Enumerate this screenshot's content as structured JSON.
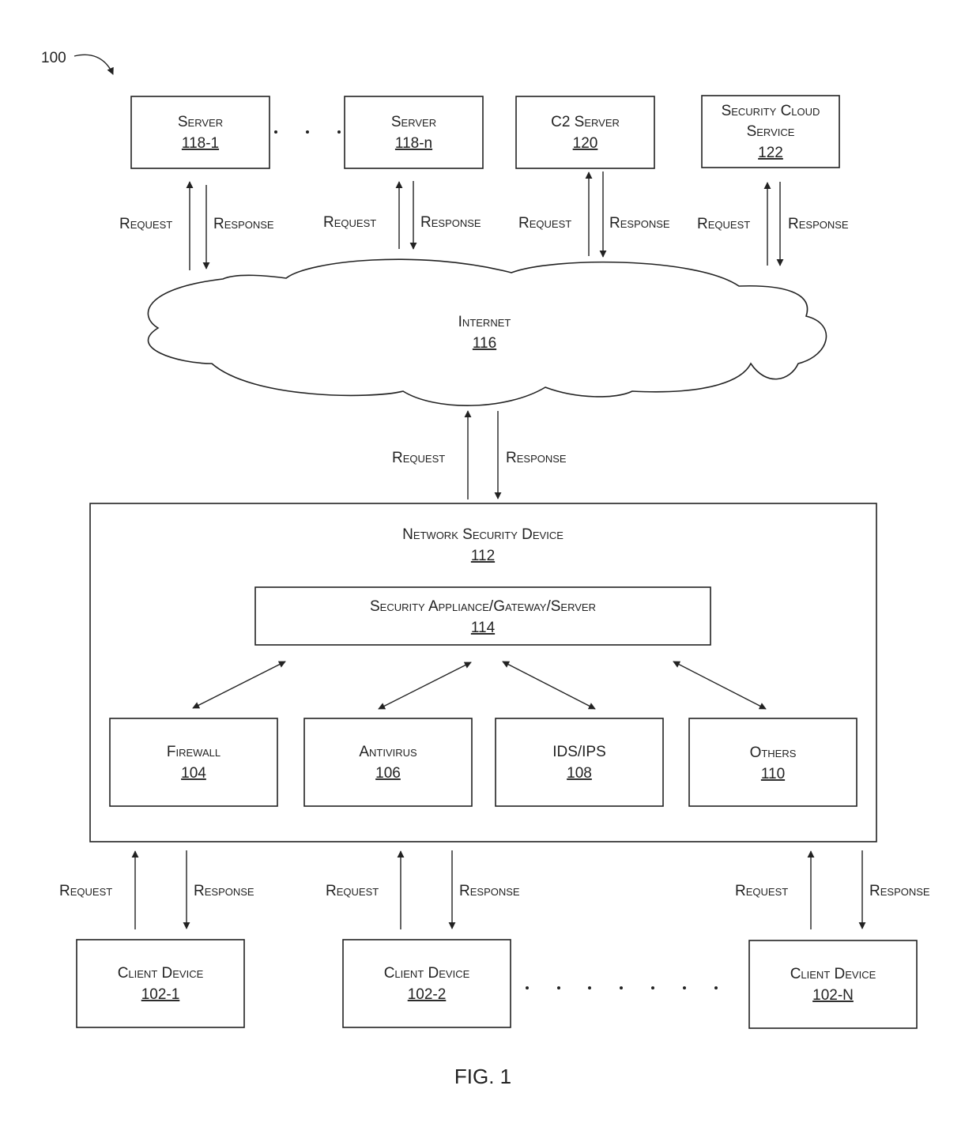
{
  "diagram_ref": "100",
  "figure_caption": "FIG. 1",
  "request_label": "Request",
  "response_label": "Response",
  "servers": [
    {
      "name": "Server",
      "number": "118-1"
    },
    {
      "name": "Server",
      "number": "118-n"
    },
    {
      "name": "C2 Server",
      "number": "120"
    },
    {
      "name_line1": "Security Cloud",
      "name_line2": "Service",
      "number": "122"
    }
  ],
  "internet": {
    "name": "Internet",
    "number": "116"
  },
  "network_security_device": {
    "name": "Network Security Device",
    "number": "112"
  },
  "security_appliance": {
    "name": "Security Appliance/Gateway/Server",
    "number": "114"
  },
  "components": [
    {
      "name": "Firewall",
      "number": "104"
    },
    {
      "name": "Antivirus",
      "number": "106"
    },
    {
      "name": "IDS/IPS",
      "number": "108"
    },
    {
      "name": "Others",
      "number": "110"
    }
  ],
  "clients": [
    {
      "name": "Client Device",
      "number": "102-1"
    },
    {
      "name": "Client Device",
      "number": "102-2"
    },
    {
      "name": "Client Device",
      "number": "102-N"
    }
  ]
}
